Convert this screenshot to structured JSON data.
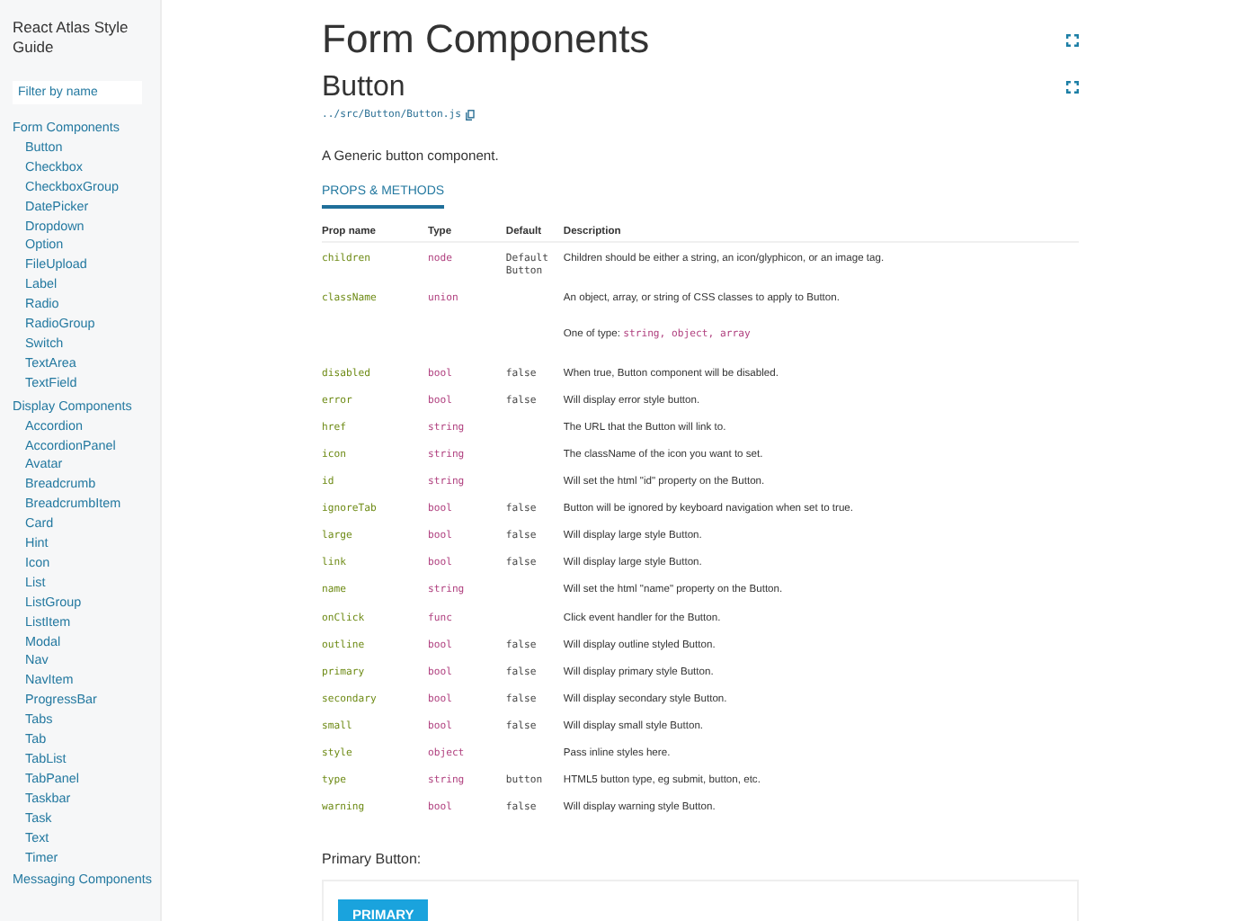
{
  "sidebar": {
    "title": "React Atlas Style Guide",
    "filter": {
      "placeholder": "Filter by name"
    },
    "groups": [
      {
        "title": "Form Components",
        "items": [
          "Button",
          "Checkbox",
          "CheckboxGroup",
          "DatePicker",
          "Dropdown",
          "Option",
          "FileUpload",
          "Label",
          "Radio",
          "RadioGroup",
          "Switch",
          "TextArea",
          "TextField"
        ]
      },
      {
        "title": "Display Components",
        "items": [
          "Accordion",
          "AccordionPanel",
          "Avatar",
          "Breadcrumb",
          "BreadcrumbItem",
          "Card",
          "Hint",
          "Icon",
          "List",
          "ListGroup",
          "ListItem",
          "Modal",
          "Nav",
          "NavItem",
          "ProgressBar",
          "Tabs",
          "Tab",
          "TabList",
          "TabPanel",
          "Taskbar",
          "Task",
          "Text",
          "Timer"
        ]
      },
      {
        "title": "Messaging Components"
      }
    ]
  },
  "page": {
    "title": "Form Components",
    "component": {
      "name": "Button",
      "path": "../src/Button/Button.js",
      "description": "A Generic button component.",
      "tabs": [
        {
          "label": "PROPS & METHODS",
          "selected": true
        }
      ],
      "table": {
        "columns": [
          "Prop name",
          "Type",
          "Default",
          "Description"
        ],
        "rows": [
          {
            "name": "children",
            "type": "node",
            "default": "Default Button",
            "description": "Children should be either a string, an icon/glyphicon, or an image tag."
          },
          {
            "name": "className",
            "type": "union",
            "description": "An object, array, or string of CSS classes to apply to Button.",
            "note": {
              "label": "One of type:",
              "values": "string, object, array"
            }
          },
          {
            "name": "disabled",
            "type": "bool",
            "default": "false",
            "description": "When true, Button component will be disabled."
          },
          {
            "name": "error",
            "type": "bool",
            "default": "false",
            "description": "Will display error style button."
          },
          {
            "name": "href",
            "type": "string",
            "description": "The URL that the Button will link to."
          },
          {
            "name": "icon",
            "type": "string",
            "description": "The className of the icon you want to set."
          },
          {
            "name": "id",
            "type": "string",
            "description": "Will set the html \"id\" property on the Button."
          },
          {
            "name": "ignoreTab",
            "type": "bool",
            "default": "false",
            "description": "Button will be ignored by keyboard navigation when set to true."
          },
          {
            "name": "large",
            "type": "bool",
            "default": "false",
            "description": "Will display large style Button."
          },
          {
            "name": "link",
            "type": "bool",
            "default": "false",
            "description": "Will display large style Button."
          },
          {
            "name": "name",
            "type": "string",
            "description": "Will set the html \"name\" property on the Button."
          },
          {
            "name": "onClick",
            "type": "func",
            "description": "Click event handler for the Button."
          },
          {
            "name": "outline",
            "type": "bool",
            "default": "false",
            "description": "Will display outline styled Button."
          },
          {
            "name": "primary",
            "type": "bool",
            "default": "false",
            "description": "Will display primary style Button."
          },
          {
            "name": "secondary",
            "type": "bool",
            "default": "false",
            "description": "Will display secondary style Button."
          },
          {
            "name": "small",
            "type": "bool",
            "default": "false",
            "description": "Will display small style Button."
          },
          {
            "name": "style",
            "type": "object",
            "description": "Pass inline styles here."
          },
          {
            "name": "type",
            "type": "string",
            "default": "button",
            "description": "HTML5 button type, eg submit, button, etc."
          },
          {
            "name": "warning",
            "type": "bool",
            "default": "false",
            "description": "Will display warning style Button."
          }
        ]
      },
      "example": {
        "title": "Primary Button:",
        "button": "PRIMARY"
      }
    }
  }
}
